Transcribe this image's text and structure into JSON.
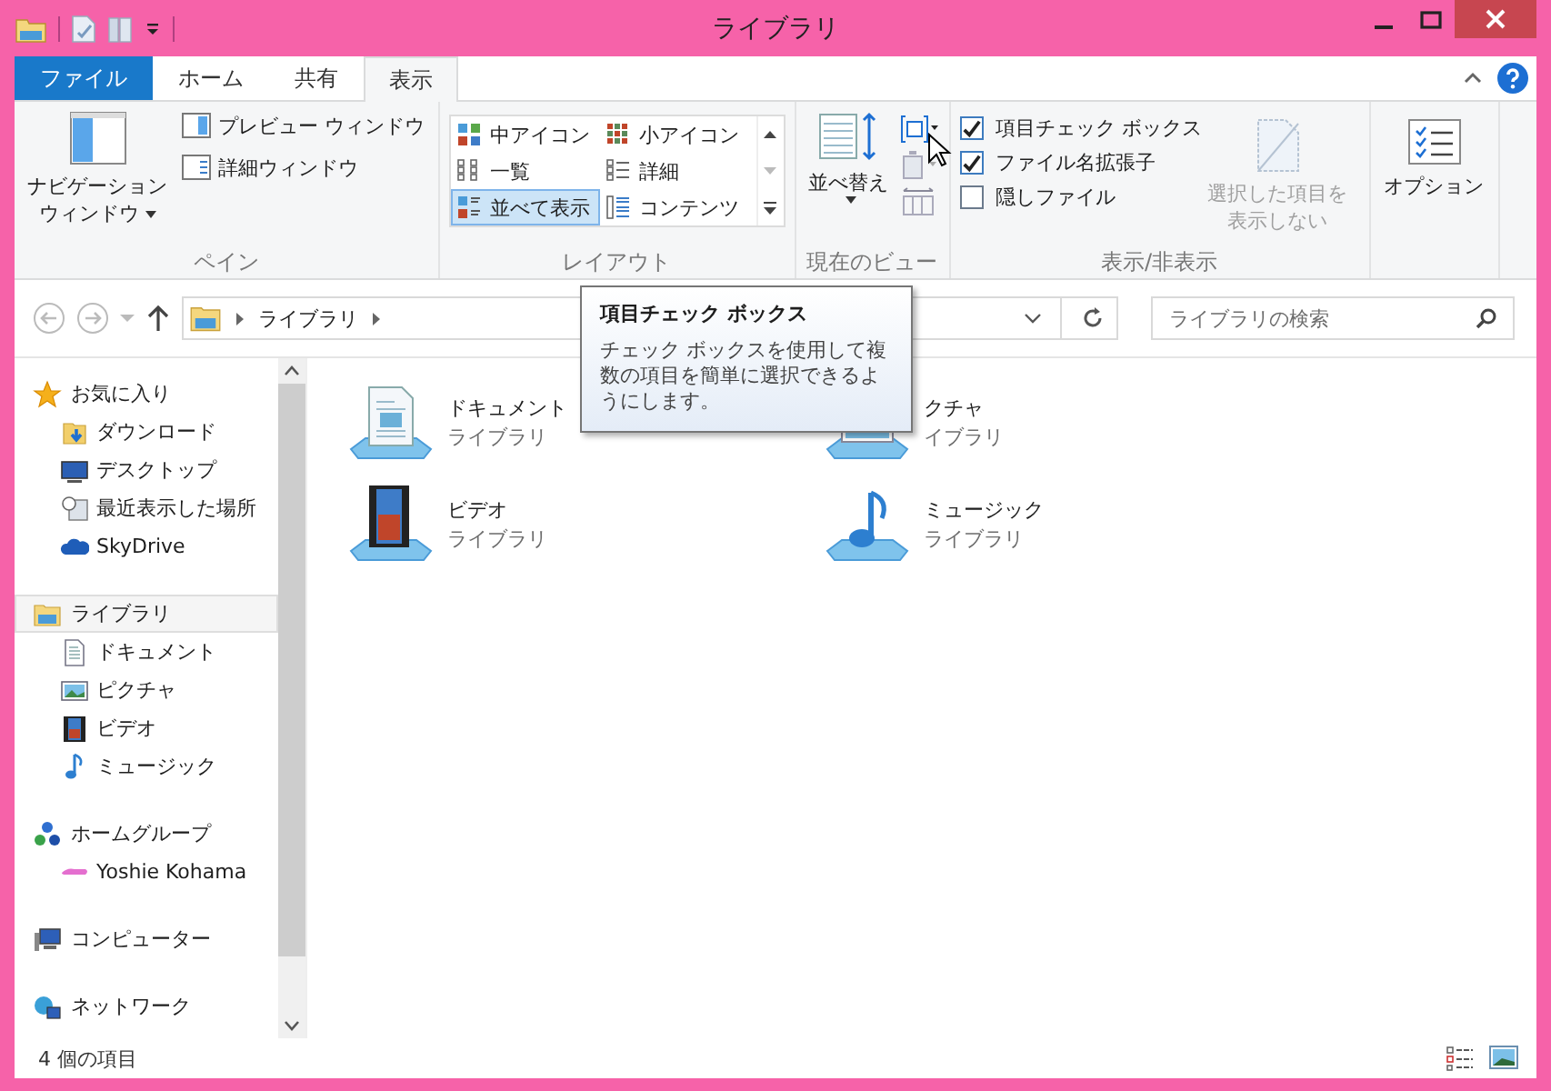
{
  "window": {
    "title": "ライブラリ"
  },
  "ribbon_tabs": [
    {
      "label": "ファイル",
      "kind": "file",
      "selected": false
    },
    {
      "label": "ホーム",
      "kind": "tab",
      "selected": false
    },
    {
      "label": "共有",
      "kind": "tab",
      "selected": false
    },
    {
      "label": "表示",
      "kind": "tab",
      "selected": true
    }
  ],
  "panes_group": {
    "label": "ペイン",
    "navigation_pane": [
      "ナビゲーション",
      "ウィンドウ"
    ],
    "preview_pane": "プレビュー ウィンドウ",
    "details_pane": "詳細ウィンドウ"
  },
  "layout_group": {
    "label": "レイアウト",
    "options": [
      {
        "label": "中アイコン",
        "kind": "medium",
        "selected": false
      },
      {
        "label": "小アイコン",
        "kind": "small",
        "selected": false
      },
      {
        "label": "一覧",
        "kind": "list",
        "selected": false
      },
      {
        "label": "詳細",
        "kind": "details",
        "selected": false
      },
      {
        "label": "並べて表示",
        "kind": "tiles",
        "selected": true
      },
      {
        "label": "コンテンツ",
        "kind": "content",
        "selected": false
      }
    ]
  },
  "current_view_group": {
    "label": "現在のビュー",
    "sort_by": "並べ替え"
  },
  "show_hide_group": {
    "label": "表示/非表示",
    "checkboxes": [
      {
        "label": "項目チェック ボックス",
        "checked": true
      },
      {
        "label": "ファイル名拡張子",
        "checked": true
      },
      {
        "label": "隠しファイル",
        "checked": false
      }
    ],
    "hide_selected": {
      "label": [
        "選択した項目を",
        "表示しない"
      ],
      "disabled": true
    }
  },
  "options": {
    "label": "オプション"
  },
  "address_bar": {
    "path": [
      "ライブラリ"
    ],
    "search_placeholder": "ライブラリの検索"
  },
  "navigation": [
    {
      "label": "お気に入り",
      "kind": "favorites",
      "selected": false,
      "children": [
        {
          "label": "ダウンロード",
          "kind": "downloads",
          "selected": false
        },
        {
          "label": "デスクトップ",
          "kind": "desktop",
          "selected": false
        },
        {
          "label": "最近表示した場所",
          "kind": "recent",
          "selected": false
        },
        {
          "label": "SkyDrive",
          "kind": "cloud",
          "selected": false
        }
      ]
    },
    {
      "label": "ライブラリ",
      "kind": "library",
      "selected": true,
      "children": [
        {
          "label": "ドキュメント",
          "kind": "documents",
          "selected": false
        },
        {
          "label": "ピクチャ",
          "kind": "pictures",
          "selected": false
        },
        {
          "label": "ビデオ",
          "kind": "videos",
          "selected": false
        },
        {
          "label": "ミュージック",
          "kind": "music",
          "selected": false
        }
      ]
    },
    {
      "label": "ホームグループ",
      "kind": "homegroup",
      "selected": false,
      "children": [
        {
          "label": "Yoshie Kohama",
          "kind": "user",
          "selected": false
        }
      ]
    },
    {
      "label": "コンピューター",
      "kind": "computer",
      "selected": false
    },
    {
      "label": "ネットワーク",
      "kind": "network",
      "selected": false
    }
  ],
  "items": [
    {
      "name": "ドキュメント",
      "type": "ライブラリ",
      "kind": "documents"
    },
    {
      "name": "クチャ",
      "type": "イブラリ",
      "kind": "pictures"
    },
    {
      "name": "ビデオ",
      "type": "ライブラリ",
      "kind": "videos"
    },
    {
      "name": "ミュージック",
      "type": "ライブラリ",
      "kind": "music"
    }
  ],
  "tooltip": {
    "title": "項目チェック ボックス",
    "text": "チェック ボックスを使用して複数の項目を簡単に選択できるようにします。"
  },
  "status_bar": {
    "item_count": "4 個の項目"
  }
}
